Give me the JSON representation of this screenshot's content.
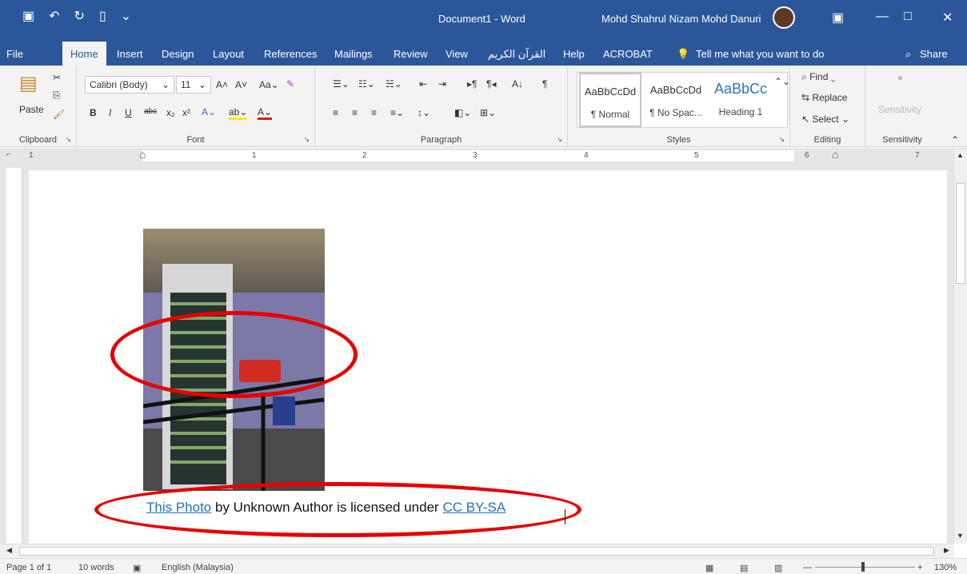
{
  "title_bar": {
    "document": "Document1 - Word",
    "user": "Mohd Shahrul Nizam Mohd Danuri"
  },
  "tabs": [
    "File",
    "Home",
    "Insert",
    "Design",
    "Layout",
    "References",
    "Mailings",
    "Review",
    "View",
    "القرآن الكريم",
    "Help",
    "ACROBAT"
  ],
  "tellme": "Tell me what you want to do",
  "share": "Share",
  "clipboard": {
    "paste": "Paste",
    "label": "Clipboard"
  },
  "font": {
    "family": "Calibri (Body)",
    "size": "11",
    "label": "Font"
  },
  "paragraph": {
    "label": "Paragraph"
  },
  "styles": {
    "items": [
      {
        "sample": "AaBbCcDd",
        "name": "¶ Normal"
      },
      {
        "sample": "AaBbCcDd",
        "name": "¶ No Spac..."
      },
      {
        "sample": "AaBbCc",
        "name": "Heading 1"
      }
    ],
    "label": "Styles"
  },
  "editing": {
    "find": "Find",
    "replace": "Replace",
    "select": "Select",
    "label": "Editing"
  },
  "sensitivity": {
    "button": "Sensitivity",
    "label": "Sensitivity"
  },
  "ruler": {
    "numbers": [
      "1",
      "1",
      "2",
      "3",
      "4",
      "5",
      "6",
      "7"
    ]
  },
  "caption": {
    "link1": "This Photo",
    "middle": " by Unknown Author is licensed under ",
    "link2": "CC BY-SA"
  },
  "status": {
    "page": "Page 1 of 1",
    "words": "10 words",
    "language": "English (Malaysia)",
    "zoom": "130%"
  },
  "colors": {
    "accent": "#2b579a",
    "annotation": "#e60000",
    "link": "#1f6fbe"
  }
}
